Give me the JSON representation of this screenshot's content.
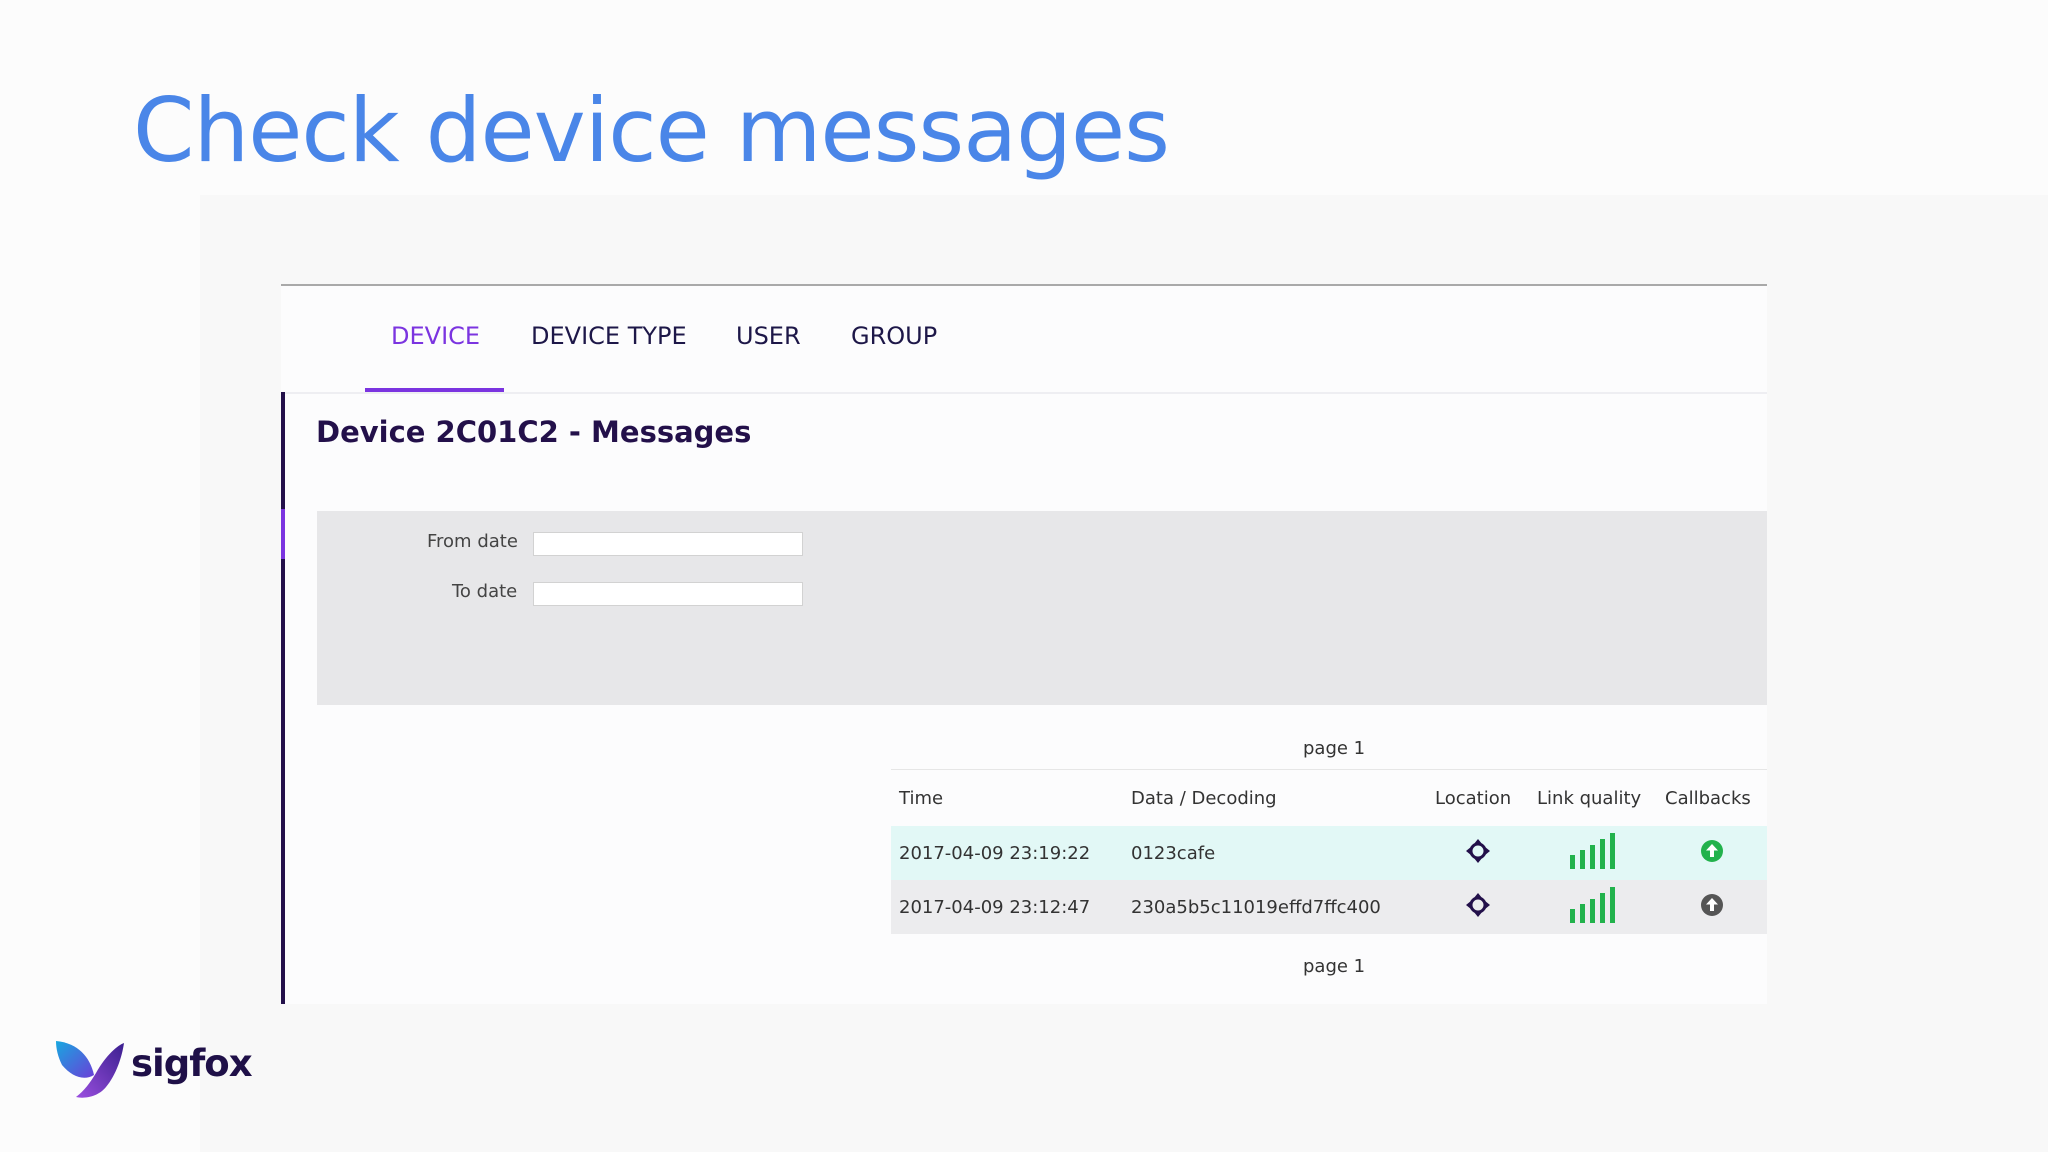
{
  "slide": {
    "title": "Check device messages"
  },
  "nav": {
    "tabs": [
      "DEVICE",
      "DEVICE TYPE",
      "USER",
      "GROUP"
    ],
    "active_tab": "DEVICE"
  },
  "page": {
    "heading": "Device 2C01C2 - Messages"
  },
  "filters": {
    "from_label": "From date",
    "from_value": "",
    "to_label": "To date",
    "to_value": ""
  },
  "pagination": {
    "top": "page 1",
    "bottom": "page 1"
  },
  "table": {
    "headers": [
      "Time",
      "Data / Decoding",
      "Location",
      "Link quality",
      "Callbacks"
    ],
    "rows": [
      {
        "time": "2017-04-09 23:19:22",
        "data": "0123cafe",
        "location_icon": "crosshair-icon",
        "link_quality_bars": 5,
        "callback_status": "success"
      },
      {
        "time": "2017-04-09 23:12:47",
        "data": "230a5b5c11019effd7ffc400",
        "location_icon": "crosshair-icon",
        "link_quality_bars": 5,
        "callback_status": "neutral"
      }
    ]
  },
  "brand": {
    "name": "sigfox"
  },
  "colors": {
    "title": "#4a86e8",
    "accent": "#7b34e0",
    "navy": "#23104a",
    "signal": "#22b24c",
    "callback_ok": "#22b24c",
    "callback_neutral": "#555555"
  }
}
